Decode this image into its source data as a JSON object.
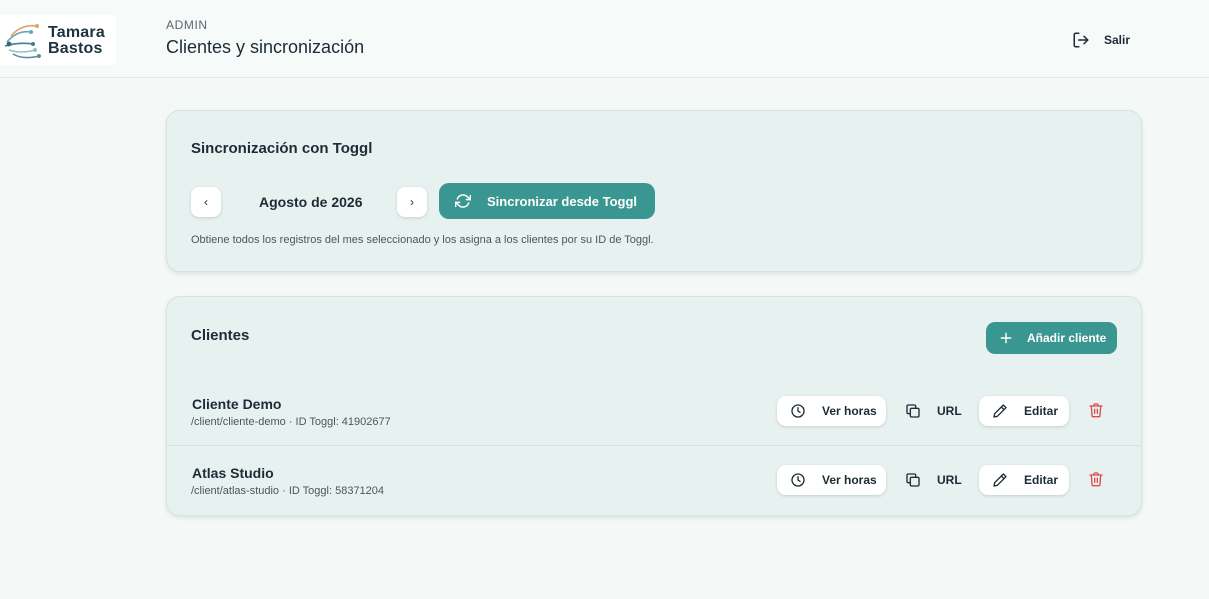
{
  "brand": {
    "line1": "Tamara",
    "line2": "Bastos"
  },
  "header": {
    "section": "ADMIN",
    "title": "Clientes y sincronización",
    "logout_label": "Salir"
  },
  "sync": {
    "title": "Sincronización con Toggl",
    "prev": "‹",
    "next": "›",
    "month": "Agosto de 2026",
    "button_label": "Sincronizar desde Toggl",
    "help": "Obtiene todos los registros del mes seleccionado y los asigna a los clientes por su ID de Toggl."
  },
  "clients": {
    "title": "Clientes",
    "add_label": "Añadir cliente",
    "actions": {
      "hours": "Ver horas",
      "url": "URL",
      "edit": "Editar"
    },
    "items": [
      {
        "name": "Cliente Demo",
        "meta": "/client/cliente-demo · ID Toggl: 41902677"
      },
      {
        "name": "Atlas Studio",
        "meta": "/client/atlas-studio · ID Toggl: 58371204"
      }
    ]
  },
  "colors": {
    "accent": "#3a9690",
    "card_bg": "#e7f2f0",
    "page_bg": "#f4f9f8",
    "danger": "#e0484d",
    "text": "#1d2b36"
  },
  "icons": {
    "logo": "circuit-tree-icon",
    "logout": "logout-icon",
    "sync": "refresh-icon",
    "add": "plus-icon",
    "hours": "clock-icon",
    "url": "copy-icon",
    "edit": "pencil-icon",
    "delete": "trash-icon"
  }
}
